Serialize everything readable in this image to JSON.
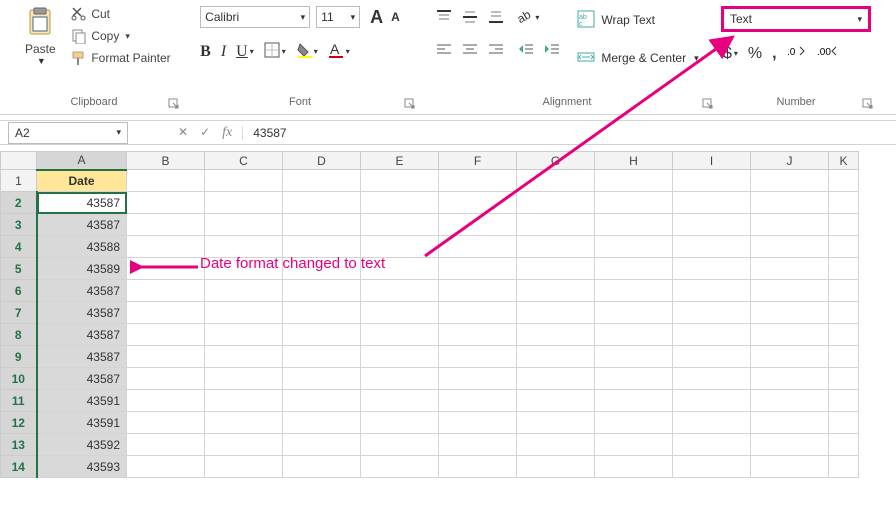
{
  "clipboard": {
    "paste_label": "Paste",
    "cut_label": "Cut",
    "copy_label": "Copy",
    "format_painter_label": "Format Painter",
    "group_label": "Clipboard"
  },
  "font": {
    "font_name": "Calibri",
    "font_size": "11",
    "bold": "B",
    "italic": "I",
    "underline": "U",
    "group_label": "Font",
    "grow_font": "A",
    "shrink_font": "A"
  },
  "alignment": {
    "wrap_text_label": "Wrap Text",
    "merge_center_label": "Merge & Center",
    "group_label": "Alignment"
  },
  "number": {
    "format_value": "Text",
    "group_label": "Number",
    "currency": "$",
    "percent": "%",
    "comma": ","
  },
  "formula_bar": {
    "name_box": "A2",
    "cancel": "✕",
    "enter": "✓",
    "fx": "fx",
    "value": "43587"
  },
  "grid": {
    "columns": [
      "A",
      "B",
      "C",
      "D",
      "E",
      "F",
      "G",
      "H",
      "I",
      "J",
      "K"
    ],
    "header_cell": "Date",
    "rows": [
      {
        "n": "1"
      },
      {
        "n": "2",
        "v": "43587"
      },
      {
        "n": "3",
        "v": "43587"
      },
      {
        "n": "4",
        "v": "43588"
      },
      {
        "n": "5",
        "v": "43589"
      },
      {
        "n": "6",
        "v": "43587"
      },
      {
        "n": "7",
        "v": "43587"
      },
      {
        "n": "8",
        "v": "43587"
      },
      {
        "n": "9",
        "v": "43587"
      },
      {
        "n": "10",
        "v": "43587"
      },
      {
        "n": "11",
        "v": "43591"
      },
      {
        "n": "12",
        "v": "43591"
      },
      {
        "n": "13",
        "v": "43592"
      },
      {
        "n": "14",
        "v": "43593"
      }
    ]
  },
  "annotation": {
    "text": "Date format changed to text"
  }
}
